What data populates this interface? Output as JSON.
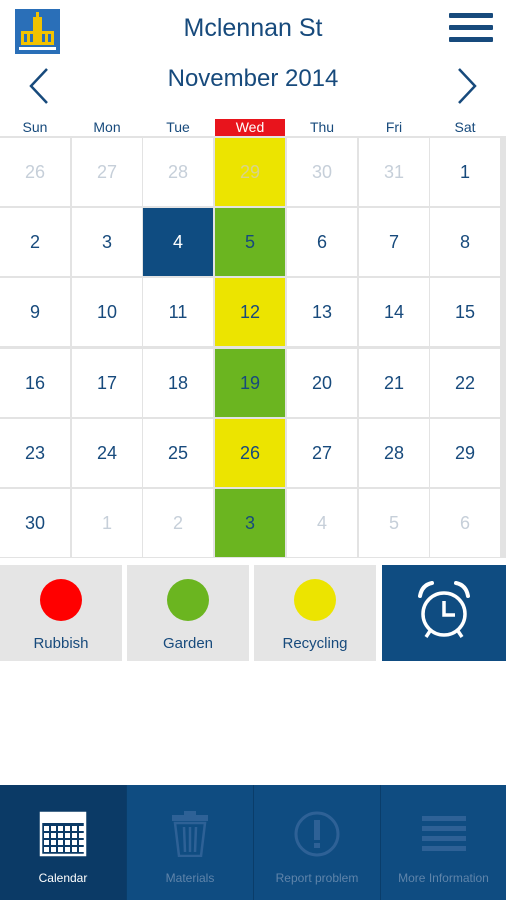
{
  "header": {
    "street": "Mclennan St"
  },
  "calendar": {
    "month_title": "November 2014",
    "weekdays": [
      "Sun",
      "Mon",
      "Tue",
      "Wed",
      "Thu",
      "Fri",
      "Sat"
    ],
    "highlight_weekday": "Wed",
    "weeks": [
      [
        {
          "d": "26",
          "t": "other"
        },
        {
          "d": "27",
          "t": "other"
        },
        {
          "d": "28",
          "t": "other"
        },
        {
          "d": "29",
          "t": "other-yellow"
        },
        {
          "d": "30",
          "t": "other"
        },
        {
          "d": "31",
          "t": "other"
        },
        {
          "d": "1",
          "t": ""
        }
      ],
      [
        {
          "d": "2",
          "t": ""
        },
        {
          "d": "3",
          "t": ""
        },
        {
          "d": "4",
          "t": "today"
        },
        {
          "d": "5",
          "t": "green"
        },
        {
          "d": "6",
          "t": ""
        },
        {
          "d": "7",
          "t": ""
        },
        {
          "d": "8",
          "t": ""
        }
      ],
      [
        {
          "d": "9",
          "t": ""
        },
        {
          "d": "10",
          "t": ""
        },
        {
          "d": "11",
          "t": ""
        },
        {
          "d": "12",
          "t": "yellow"
        },
        {
          "d": "13",
          "t": ""
        },
        {
          "d": "14",
          "t": ""
        },
        {
          "d": "15",
          "t": ""
        }
      ],
      [
        {
          "d": "16",
          "t": ""
        },
        {
          "d": "17",
          "t": ""
        },
        {
          "d": "18",
          "t": ""
        },
        {
          "d": "19",
          "t": "green"
        },
        {
          "d": "20",
          "t": ""
        },
        {
          "d": "21",
          "t": ""
        },
        {
          "d": "22",
          "t": ""
        }
      ],
      [
        {
          "d": "23",
          "t": ""
        },
        {
          "d": "24",
          "t": ""
        },
        {
          "d": "25",
          "t": ""
        },
        {
          "d": "26",
          "t": "yellow"
        },
        {
          "d": "27",
          "t": ""
        },
        {
          "d": "28",
          "t": ""
        },
        {
          "d": "29",
          "t": ""
        }
      ],
      [
        {
          "d": "30",
          "t": ""
        },
        {
          "d": "1",
          "t": "other"
        },
        {
          "d": "2",
          "t": "other"
        },
        {
          "d": "3",
          "t": "green"
        },
        {
          "d": "4",
          "t": "other"
        },
        {
          "d": "5",
          "t": "other"
        },
        {
          "d": "6",
          "t": "other"
        }
      ]
    ]
  },
  "legend": [
    {
      "label": "Rubbish",
      "color": "#ff0000",
      "name": "rubbish"
    },
    {
      "label": "Garden",
      "color": "#6bb520",
      "name": "garden"
    },
    {
      "label": "Recycling",
      "color": "#ece400",
      "name": "recycling"
    }
  ],
  "tabs": [
    {
      "label": "Calendar",
      "icon": "calendar-icon",
      "active": true
    },
    {
      "label": "Materials",
      "icon": "trash-bin-icon",
      "active": false
    },
    {
      "label": "Report problem",
      "icon": "exclamation-icon",
      "active": false
    },
    {
      "label": "More Information",
      "icon": "list-icon",
      "active": false
    }
  ],
  "colors": {
    "brand_blue": "#0f4c81",
    "today_red": "#e8141c",
    "recycling_yellow": "#ece400",
    "garden_green": "#6bb520"
  }
}
